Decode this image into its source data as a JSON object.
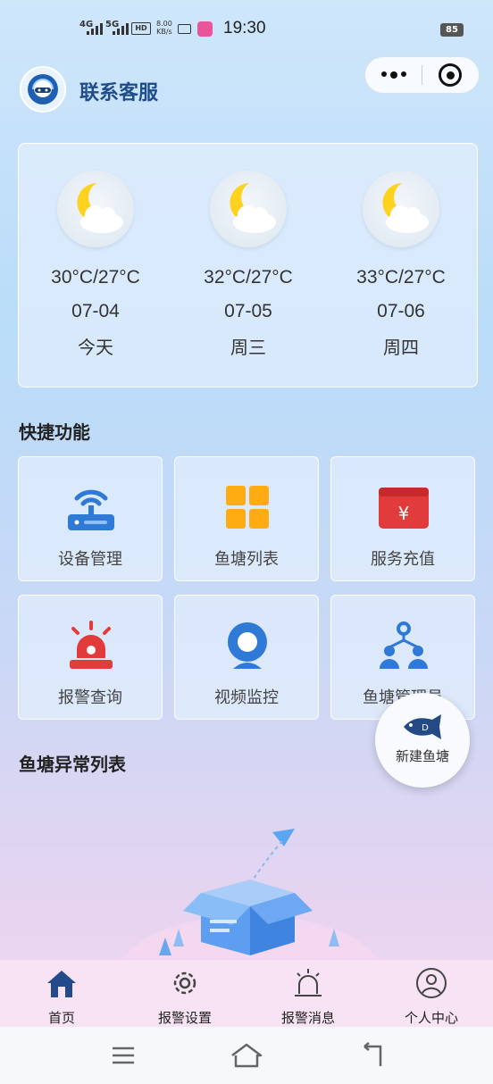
{
  "status_bar": {
    "net1": "4G",
    "net2": "5G",
    "hd": "HD",
    "speed_value": "8.00",
    "speed_unit": "KB/s",
    "time": "19:30",
    "battery": "85"
  },
  "header": {
    "title": "联系客服",
    "avatar_icon": "customer-service-icon",
    "more_icon": "more-dots-icon",
    "close_icon": "target-circle-icon"
  },
  "weather": [
    {
      "icon": "moon-cloud-icon",
      "temp": "30°C/27°C",
      "date": "07-04",
      "day": "今天"
    },
    {
      "icon": "moon-cloud-icon",
      "temp": "32°C/27°C",
      "date": "07-05",
      "day": "周三"
    },
    {
      "icon": "moon-cloud-icon",
      "temp": "33°C/27°C",
      "date": "07-06",
      "day": "周四"
    }
  ],
  "quick": {
    "title": "快捷功能",
    "items": [
      {
        "label": "设备管理",
        "icon": "router-icon"
      },
      {
        "label": "鱼塘列表",
        "icon": "grid-icon"
      },
      {
        "label": "服务充值",
        "icon": "wallet-yen-icon"
      },
      {
        "label": "报警查询",
        "icon": "alarm-light-icon"
      },
      {
        "label": "视频监控",
        "icon": "camera-icon"
      },
      {
        "label": "鱼塘管理员",
        "icon": "team-icon"
      }
    ]
  },
  "fab": {
    "label": "新建鱼塘",
    "icon": "fish-icon"
  },
  "anomaly": {
    "title": "鱼塘异常列表",
    "empty_icon": "empty-box-icon"
  },
  "tabs": [
    {
      "label": "首页",
      "icon": "home-icon"
    },
    {
      "label": "报警设置",
      "icon": "gear-icon"
    },
    {
      "label": "报警消息",
      "icon": "alarm-icon"
    },
    {
      "label": "个人中心",
      "icon": "user-icon"
    }
  ],
  "colors": {
    "accent_blue": "#2e7ad6",
    "title_blue": "#1f4c8a",
    "alert_red": "#e23b3b",
    "grid_orange": "#ffac12",
    "tab_active": "#234a8a"
  }
}
